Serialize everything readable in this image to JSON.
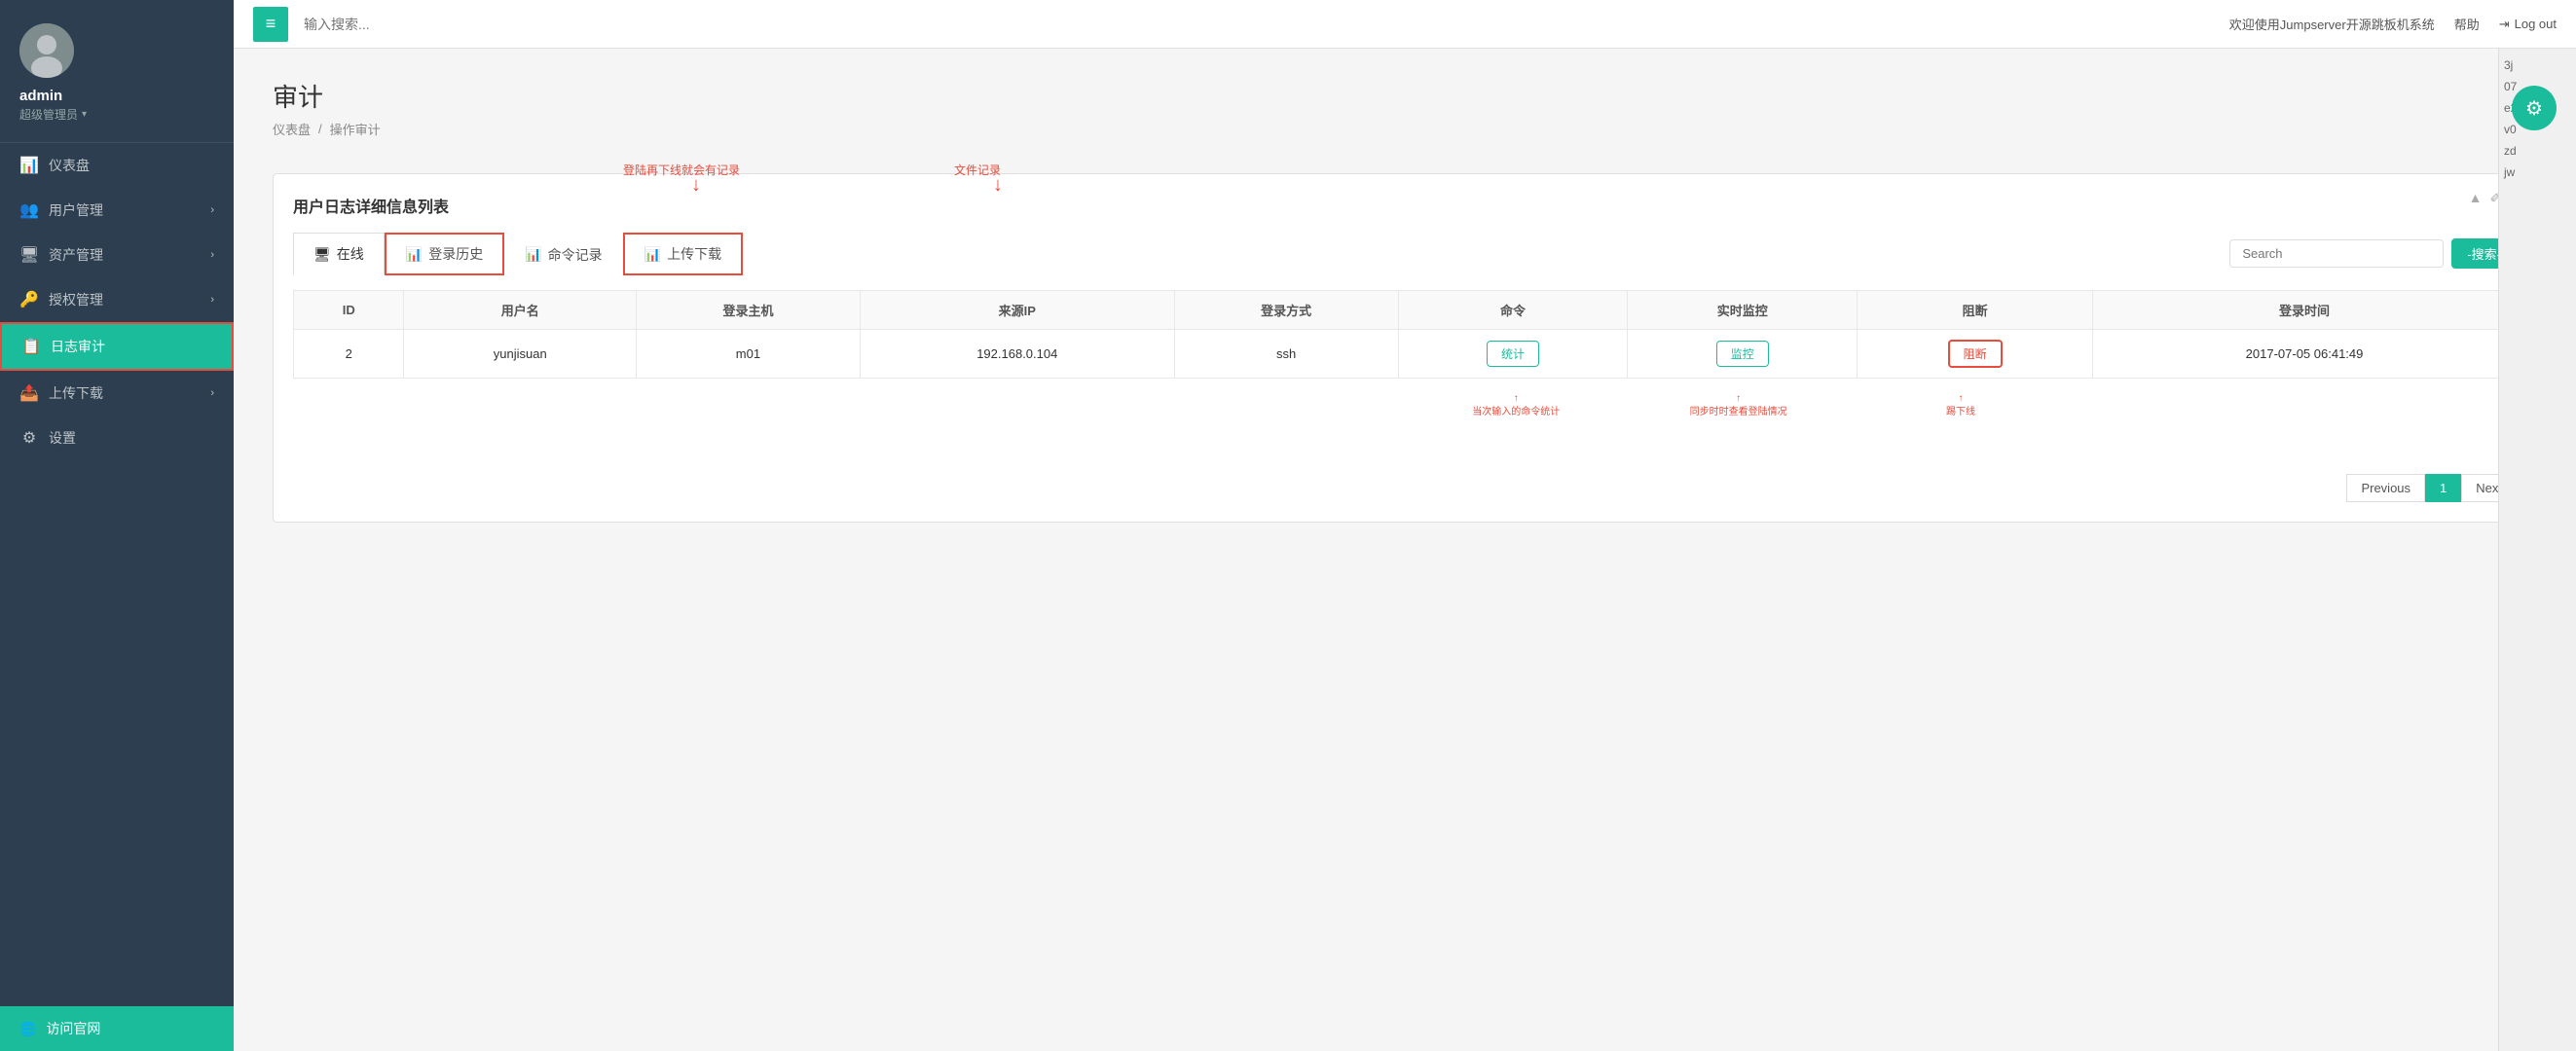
{
  "sidebar": {
    "username": "admin",
    "role": "超级管理员",
    "avatar_char": "👤",
    "nav_items": [
      {
        "id": "dashboard",
        "icon": "📊",
        "label": "仪表盘",
        "active": false,
        "has_chevron": false
      },
      {
        "id": "user-mgmt",
        "icon": "👥",
        "label": "用户管理",
        "active": false,
        "has_chevron": true
      },
      {
        "id": "asset-mgmt",
        "icon": "🖥",
        "label": "资产管理",
        "active": false,
        "has_chevron": true
      },
      {
        "id": "auth-mgmt",
        "icon": "🔑",
        "label": "授权管理",
        "active": false,
        "has_chevron": true
      },
      {
        "id": "log-audit",
        "icon": "📋",
        "label": "日志审计",
        "active": true,
        "has_chevron": false,
        "highlighted": true
      },
      {
        "id": "upload-dl",
        "icon": "📤",
        "label": "上传下载",
        "active": false,
        "has_chevron": true
      },
      {
        "id": "settings",
        "icon": "⚙",
        "label": "设置",
        "active": false,
        "has_chevron": false
      }
    ],
    "bottom_item": {
      "icon": "🌐",
      "label": "访问官网"
    }
  },
  "header": {
    "menu_icon": "≡",
    "search_placeholder": "输入搜索...",
    "welcome_text": "欢迎使用Jumpserver开源跳板机系统",
    "help_label": "帮助",
    "logout_label": "Log out"
  },
  "page": {
    "title": "审计",
    "breadcrumb_home": "仪表盘",
    "breadcrumb_separator": "/",
    "breadcrumb_current": "操作审计"
  },
  "gear_btn": "⚙",
  "annotations": {
    "login_note": "登陆再下线就会有记录",
    "file_note": "文件记录",
    "cmd_note": "当次输入的命令统计",
    "monitor_note": "同步时时查看登陆情况",
    "block_note": "踢下线"
  },
  "card": {
    "title": "用户日志详细信息列表",
    "controls": [
      "▲",
      "✐",
      "✕"
    ],
    "tabs": [
      {
        "id": "online",
        "icon": "🖥",
        "label": "在线",
        "active": true
      },
      {
        "id": "login-history",
        "icon": "📊",
        "label": "登录历史",
        "active": false,
        "highlighted": true
      },
      {
        "id": "cmd-record",
        "icon": "📊",
        "label": "命令记录",
        "active": false
      },
      {
        "id": "upload-download",
        "icon": "📊",
        "label": "上传下载",
        "active": false,
        "highlighted": true
      }
    ],
    "search_placeholder": "Search",
    "search_btn_label": "-搜索-",
    "table": {
      "columns": [
        "ID",
        "用户名",
        "登录主机",
        "来源IP",
        "登录方式",
        "命令",
        "实时监控",
        "阻断",
        "登录时间"
      ],
      "rows": [
        {
          "id": "2",
          "username": "yunjisuan",
          "host": "m01",
          "source_ip": "192.168.0.104",
          "login_method": "ssh",
          "cmd_btn": "统计",
          "monitor_btn": "监控",
          "block_btn": "阻断",
          "login_time": "2017-07-05 06:41:49"
        }
      ]
    },
    "pagination": {
      "prev_label": "Previous",
      "current_page": "1",
      "next_label": "Next"
    }
  },
  "right_codes": [
    "3j",
    "07",
    "e2",
    "v0",
    "zd",
    "jw"
  ]
}
